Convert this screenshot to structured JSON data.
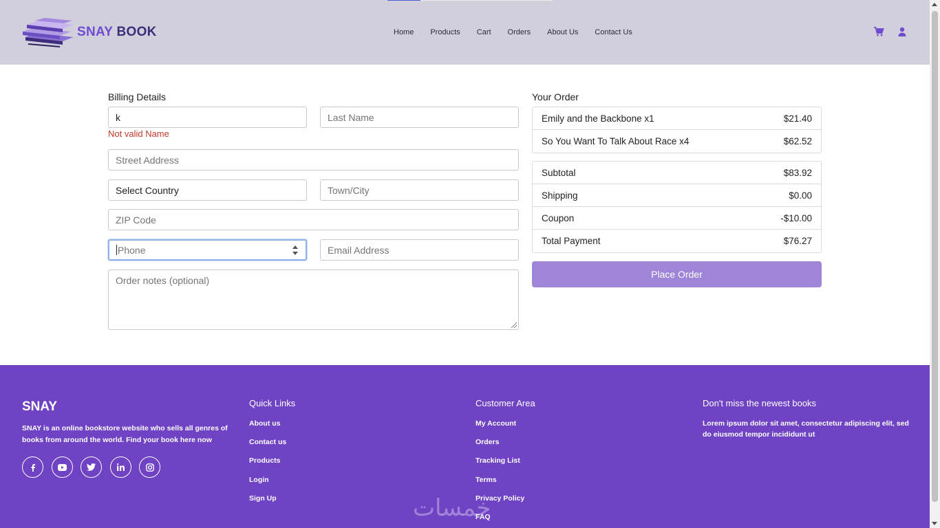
{
  "header": {
    "brand_part1": "SNAY",
    "brand_part2": "BOOK",
    "nav": [
      "Home",
      "Products",
      "Cart",
      "Orders",
      "About Us",
      "Contact Us"
    ],
    "icons": [
      "cart-icon",
      "user-icon"
    ],
    "accent_color": "#6f4bd1",
    "background_color": "#d2cfdc"
  },
  "billing": {
    "title": "Billing Details",
    "first_name_value": "k",
    "first_name_error": "Not valid Name",
    "last_name_placeholder": "Last Name",
    "street_placeholder": "Street Address",
    "country_value": "Select Country",
    "town_placeholder": "Town/City",
    "zip_placeholder": "ZIP Code",
    "phone_placeholder": "Phone",
    "email_placeholder": "Email Address",
    "notes_placeholder": "Order notes (optional)"
  },
  "order": {
    "title": "Your Order",
    "items": [
      {
        "name": "Emily and the Backbone x1",
        "price": "$21.40"
      },
      {
        "name": "So You Want To Talk About Race x4",
        "price": "$62.52"
      }
    ],
    "totals": [
      {
        "label": "Subtotal",
        "value": "$83.92"
      },
      {
        "label": "Shipping",
        "value": "$0.00"
      },
      {
        "label": "Coupon",
        "value": "-$10.00"
      },
      {
        "label": "Total Payment",
        "value": "$76.27"
      }
    ],
    "place_order_label": "Place Order",
    "button_color": "#9e85d8"
  },
  "footer": {
    "brand": "SNAY",
    "description": "SNAY is an online bookstore website who sells all genres of books from around the world. Find your book here now",
    "socials": [
      "facebook-icon",
      "youtube-icon",
      "twitter-icon",
      "linkedin-icon",
      "instagram-icon"
    ],
    "quick_links_title": "Quick Links",
    "quick_links": [
      "About us",
      "Contact us",
      "Products",
      "Login",
      "Sign Up"
    ],
    "customer_area_title": "Customer Area",
    "customer_links": [
      "My Account",
      "Orders",
      "Tracking List",
      "Terms",
      "Privacy Policy",
      "FAQ"
    ],
    "newsletter_title": "Don't miss the newest books",
    "newsletter_text": "Lorem ipsum dolor sit amet, consectetur adipiscing elit, sed do eiusmod tempor incididunt ut",
    "watermark": "خمسات",
    "background_color": "#6f43c4"
  }
}
